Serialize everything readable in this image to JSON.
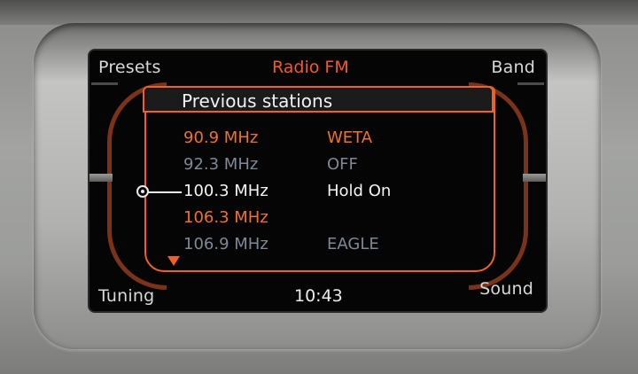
{
  "header": {
    "left_label": "Presets",
    "title": "Radio FM",
    "right_label": "Band"
  },
  "footer": {
    "left_label": "Tuning",
    "clock": "10:43",
    "right_label": "Sound"
  },
  "list": {
    "title": "Previous stations",
    "rows": [
      {
        "frequency": "90.9 MHz",
        "name": "WETA",
        "state": "orange"
      },
      {
        "frequency": "92.3 MHz",
        "name": "OFF",
        "state": "grey"
      },
      {
        "frequency": "100.3 MHz",
        "name": "Hold On",
        "state": "selected"
      },
      {
        "frequency": "106.3 MHz",
        "name": "",
        "state": "orange"
      },
      {
        "frequency": "106.9 MHz",
        "name": "EAGLE",
        "state": "grey"
      }
    ],
    "scroll_indicator_icon": "down-arrow-icon",
    "selector_icon": "selection-knob-icon"
  },
  "colors": {
    "accent_orange": "#f0602a",
    "text_white": "#f4f4f4",
    "text_grey": "#7c8996",
    "screen_bg": "#050505"
  }
}
